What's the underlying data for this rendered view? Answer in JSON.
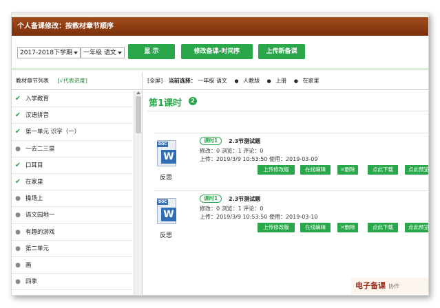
{
  "window": {
    "title": "个人备课修改：按教材章节顺序"
  },
  "toolbar": {
    "term_select": "2017-2018下学期",
    "grade_select": "一年级 语文",
    "show_button": "显  示",
    "edit_button": "修改备课-时间序",
    "upload_button": "上传新备课"
  },
  "sidebar": {
    "header": "教材章节列表",
    "progress_note": "[√代表进度]",
    "items": [
      {
        "label": "入学教育",
        "done": true
      },
      {
        "label": "汉语拼音",
        "done": true
      },
      {
        "label": "第一单元 识字（一）",
        "done": true
      },
      {
        "label": "一去二三里",
        "done": false
      },
      {
        "label": "口耳目",
        "done": true
      },
      {
        "label": "在家里",
        "done": true
      },
      {
        "label": "操场上",
        "done": false
      },
      {
        "label": "语文园地一",
        "done": false
      },
      {
        "label": "有趣的游戏",
        "done": false
      },
      {
        "label": "第二单元",
        "done": false
      },
      {
        "label": "画",
        "done": false
      },
      {
        "label": "四季",
        "done": false
      }
    ],
    "check_glyph": "✔",
    "dot_glyph": "●"
  },
  "breadcrumb": {
    "full_screen": "[全屏]",
    "current_label": "当前选择：",
    "items": [
      "一年级 语文",
      "人教版",
      "上册",
      "在家里"
    ],
    "sep_glyph": "●"
  },
  "section": {
    "title": "第1课时",
    "count": "2"
  },
  "cards": [
    {
      "tag": "课时1",
      "title": "2.3节测试题",
      "stats": "修改：0   浏览：1   评论：0",
      "dates": "上传：2019/3/9 10:53:50   使用：2019-03-09",
      "doc_label": "反思",
      "doc_band": "DOC",
      "doc_letter": "W",
      "actions": [
        "上传修改版",
        "在线编辑",
        "×删除",
        "点此下载",
        "点此预览"
      ]
    },
    {
      "tag": "课时1",
      "title": "2.3节测试题",
      "stats": "修改：0   浏览：1   评论：0",
      "dates": "上传：2019/3/9 10:53:50   使用：2019-03-10",
      "doc_label": "反思",
      "doc_band": "DOC",
      "doc_letter": "W",
      "actions": [
        "上传修改版",
        "在线编辑",
        "×删除",
        "点此下载",
        "点此预览"
      ]
    }
  ],
  "watermark": {
    "text": "电子备课",
    "sub": "协作"
  },
  "colors": {
    "accent": "#2aa64b",
    "titlebar": "#8a3a12"
  }
}
